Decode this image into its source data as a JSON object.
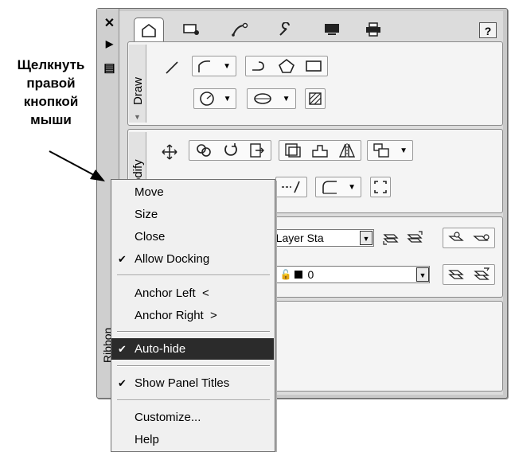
{
  "annotation": {
    "lines": [
      "Щелкнуть",
      "правой",
      "кнопкой",
      "мыши"
    ]
  },
  "palette": {
    "title_controls": [
      "✕",
      "▶",
      "▤"
    ],
    "vertical_title": "Ribbon",
    "tabs": [
      {
        "icon": "home-icon",
        "glyph": "⌂"
      },
      {
        "icon": "blocks-icon",
        "glyph": "▭"
      },
      {
        "icon": "annotate-icon",
        "glyph": "↗"
      },
      {
        "icon": "tools-icon",
        "glyph": "🔧"
      },
      {
        "icon": "view-icon",
        "glyph": "▭"
      },
      {
        "icon": "output-icon",
        "glyph": "🖶"
      }
    ],
    "help_label": "?",
    "panels": {
      "draw": {
        "title": "Draw"
      },
      "modify": {
        "title": "odify"
      }
    },
    "layers": {
      "state_value": "d Layer Sta",
      "layer_value": "0"
    }
  },
  "context_menu": {
    "items": [
      {
        "label": "Move",
        "checked": false,
        "highlight": false
      },
      {
        "label": "Size",
        "checked": false,
        "highlight": false
      },
      {
        "label": "Close",
        "checked": false,
        "highlight": false
      },
      {
        "label": "Allow Docking",
        "checked": true,
        "highlight": false
      },
      {
        "label": "Anchor Left  <",
        "checked": false,
        "highlight": false
      },
      {
        "label": "Anchor Right  >",
        "checked": false,
        "highlight": false
      },
      {
        "label": "Auto-hide",
        "checked": true,
        "highlight": true
      },
      {
        "label": "Show Panel Titles",
        "checked": true,
        "highlight": false
      },
      {
        "label": "Customize...",
        "checked": false,
        "highlight": false
      },
      {
        "label": "Help",
        "checked": false,
        "highlight": false
      }
    ],
    "check_glyph": "✔"
  }
}
